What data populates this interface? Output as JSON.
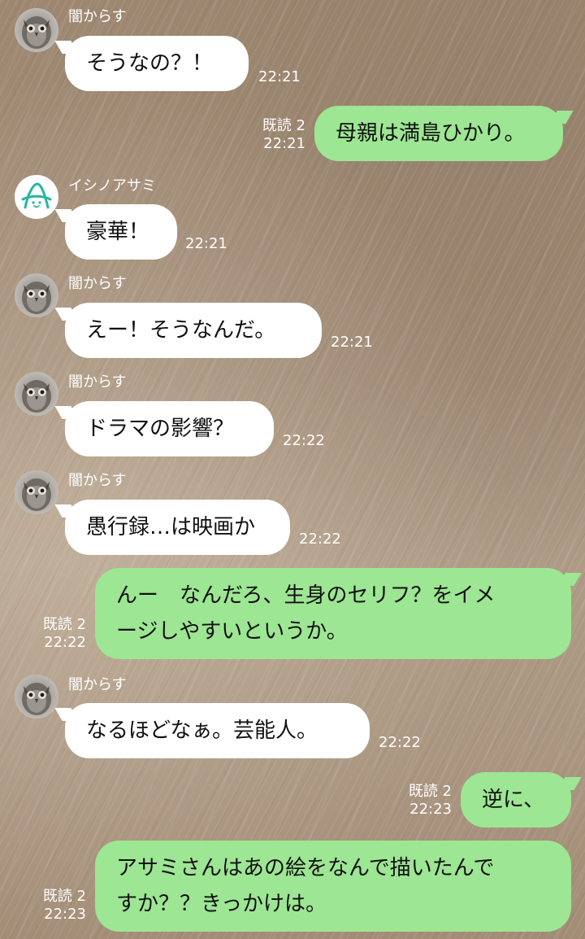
{
  "conversation": {
    "messages": [
      {
        "sender": "闇からす",
        "text": "そうなの？！",
        "time": "22:21"
      },
      {
        "text": "母親は満島ひかり。",
        "read": "既読 2",
        "time": "22:21"
      },
      {
        "sender": "イシノアサミ",
        "text": "豪華！",
        "time": "22:21"
      },
      {
        "sender": "闇からす",
        "text": "えー！そうなんだ。",
        "time": "22:21"
      },
      {
        "sender": "闇からす",
        "text": "ドラマの影響？",
        "time": "22:22"
      },
      {
        "sender": "闇からす",
        "text": "愚行録…は映画か",
        "time": "22:22"
      },
      {
        "text_line1": "んー　なんだろ、生身のセリフ？をイメ",
        "text_line2": "ージしやすいというか。",
        "read": "既読 2",
        "time": "22:22"
      },
      {
        "sender": "闇からす",
        "text": "なるほどなぁ。芸能人。",
        "time": "22:22"
      },
      {
        "text": "逆に、",
        "read": "既読 2",
        "time": "22:23"
      },
      {
        "text_line1": "アサミさんはあの絵をなんで描いたんで",
        "text_line2": "すか？？きっかけは。",
        "read": "既読 2",
        "time": "22:23"
      }
    ]
  },
  "avatars": {
    "owl": "owl-avatar",
    "asami": "asami-logo-avatar",
    "asami_color": "#27b6a0"
  },
  "colors": {
    "outgoing_bubble": "#9de693",
    "incoming_bubble": "#ffffff"
  }
}
